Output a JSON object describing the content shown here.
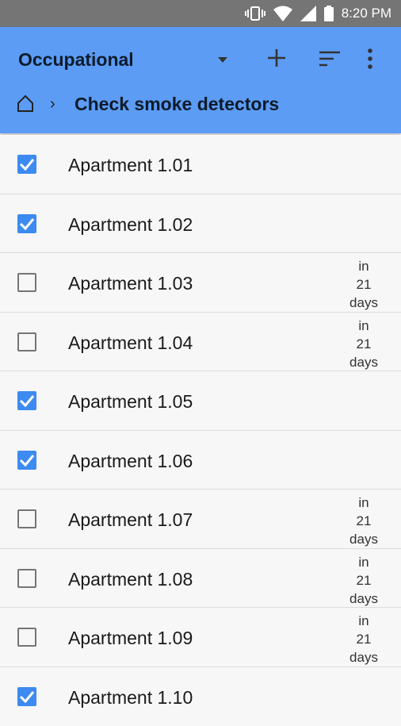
{
  "status_bar": {
    "time": "8:20 PM",
    "icons": [
      "vibrate-icon",
      "wifi-icon",
      "signal-icon",
      "battery-icon"
    ]
  },
  "app_bar": {
    "title": "Occupational",
    "breadcrumb_current": "Check smoke detectors",
    "breadcrumb_separator": "›",
    "actions": [
      "dropdown-arrow-icon",
      "add-icon",
      "sort-icon",
      "more-vert-icon"
    ],
    "background_color": "#5c9cf5"
  },
  "colors": {
    "checkbox_checked": "#3d8af0",
    "checkbox_unchecked": "#757575"
  },
  "items": [
    {
      "label": "Apartment 1.01",
      "checked": true,
      "due": null
    },
    {
      "label": "Apartment 1.02",
      "checked": true,
      "due": null
    },
    {
      "label": "Apartment 1.03",
      "checked": false,
      "due": {
        "line1": "in",
        "line2": "21",
        "line3": "days"
      }
    },
    {
      "label": "Apartment 1.04",
      "checked": false,
      "due": {
        "line1": "in",
        "line2": "21",
        "line3": "days"
      }
    },
    {
      "label": "Apartment 1.05",
      "checked": true,
      "due": null
    },
    {
      "label": "Apartment 1.06",
      "checked": true,
      "due": null
    },
    {
      "label": "Apartment 1.07",
      "checked": false,
      "due": {
        "line1": "in",
        "line2": "21",
        "line3": "days"
      }
    },
    {
      "label": "Apartment 1.08",
      "checked": false,
      "due": {
        "line1": "in",
        "line2": "21",
        "line3": "days"
      }
    },
    {
      "label": "Apartment 1.09",
      "checked": false,
      "due": {
        "line1": "in",
        "line2": "21",
        "line3": "days"
      }
    },
    {
      "label": "Apartment 1.10",
      "checked": true,
      "due": null
    }
  ]
}
